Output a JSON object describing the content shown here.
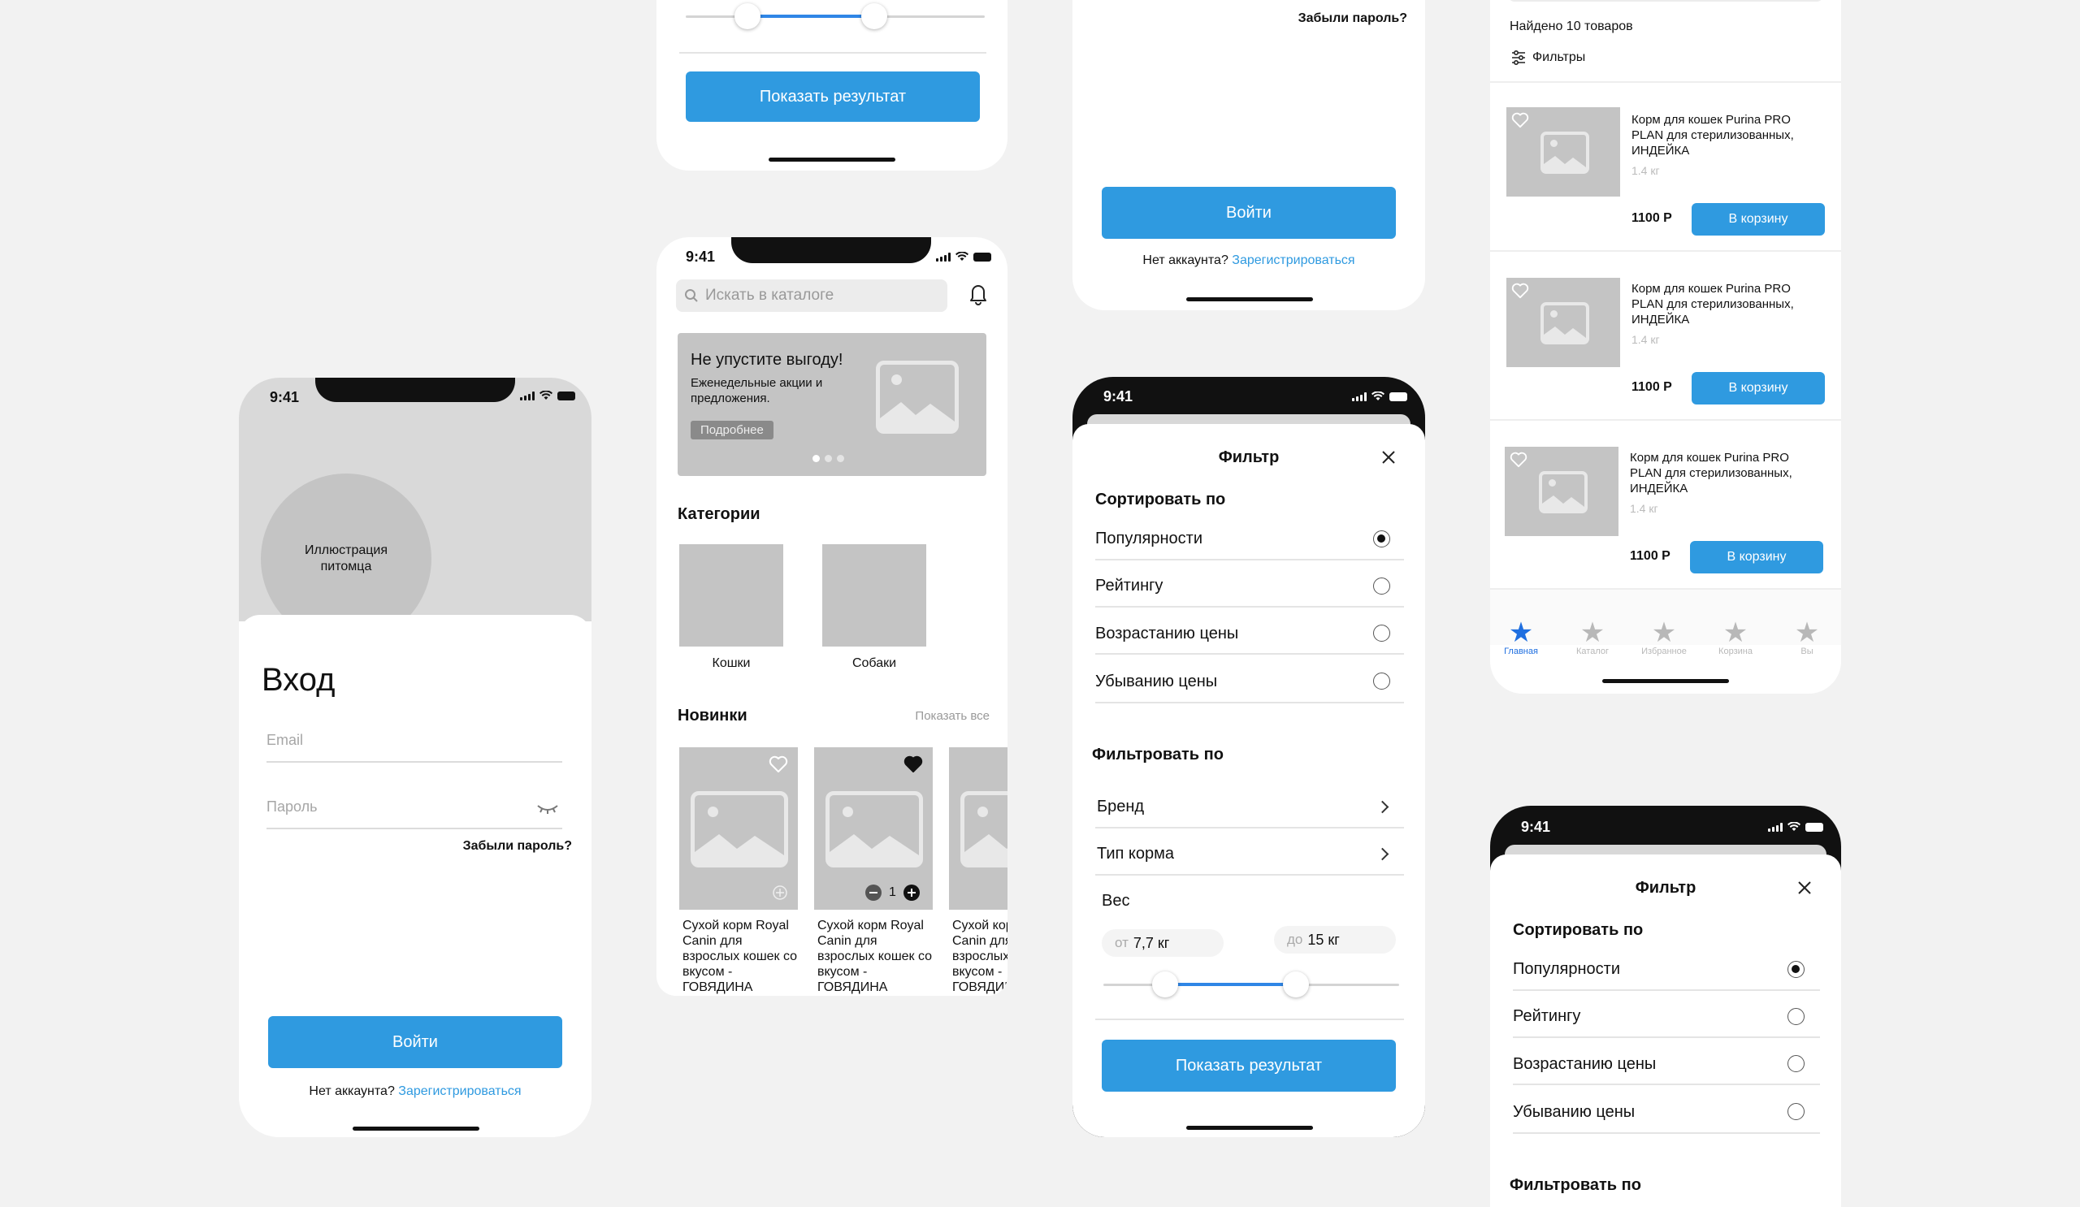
{
  "status": {
    "time": "9:41"
  },
  "login": {
    "illustration": "Иллюстрация питомца",
    "title": "Вход",
    "email_placeholder": "Email",
    "password_placeholder": "Пароль",
    "forgot": "Забыли пароль?",
    "submit": "Войти",
    "no_account": "Нет аккаунта?",
    "register": "Зарегистрироваться"
  },
  "login_partial": {
    "forgot": "Забыли пароль?",
    "submit": "Войти",
    "no_account": "Нет аккаунта?",
    "register": "Зарегистрироваться"
  },
  "filter_partial_top": {
    "show_result": "Показать результат"
  },
  "home": {
    "search_placeholder": "Искать в каталоге",
    "banner": {
      "title": "Не упустите выгоду!",
      "subtitle": "Еженедельные акции и предложения.",
      "more": "Подробнее"
    },
    "categories_title": "Категории",
    "categories": [
      {
        "label": "Кошки"
      },
      {
        "label": "Собаки"
      }
    ],
    "new_title": "Новинки",
    "show_all": "Показать все",
    "products": [
      {
        "name": "Сухой корм Royal Canin для взрослых кошек со вкусом - ГОВЯДИНА",
        "favorite": false
      },
      {
        "name": "Сухой корм Royal Canin для взрослых кошек со вкусом - ГОВЯДИНА",
        "favorite": true,
        "quantity": "1"
      },
      {
        "name": "Сухой корм Royal Canin для взрослых кошек со вкусом - ГОВЯДИНА",
        "favorite": false
      }
    ]
  },
  "filter": {
    "title": "Фильтр",
    "sort_title": "Сортировать по",
    "sort_options": [
      {
        "label": "Популярности",
        "selected": true
      },
      {
        "label": "Рейтингу",
        "selected": false
      },
      {
        "label": "Возрастанию цены",
        "selected": false
      },
      {
        "label": "Убыванию цены",
        "selected": false
      }
    ],
    "filter_title": "Фильтровать по",
    "filter_options": [
      {
        "label": "Бренд"
      },
      {
        "label": "Тип корма"
      }
    ],
    "weight": {
      "label": "Вес",
      "from_prefix": "от",
      "from": "7,7 кг",
      "to_prefix": "до",
      "to": "15 кг",
      "range_start": 0.21,
      "range_end": 0.65
    },
    "show_result": "Показать результат"
  },
  "catalog": {
    "found": "Найдено 10 товаров",
    "filters": "Фильтры",
    "items": [
      {
        "name": "Корм для кошек Purina PRO PLAN для стерилизованных, ИНДЕЙКА",
        "weight": "1.4 кг",
        "price": "1100 Р",
        "cart": "В корзину"
      },
      {
        "name": "Корм для кошек Purina PRO PLAN для стерилизованных, ИНДЕЙКА",
        "weight": "1.4 кг",
        "price": "1100 Р",
        "cart": "В корзину"
      },
      {
        "name": "Корм для кошек Purina PRO PLAN для стерилизованных, ИНДЕЙКА",
        "weight": "1.4 кг",
        "price": "1100 Р",
        "cart": "В корзину"
      }
    ],
    "tabs": [
      {
        "label": "Главная",
        "active": true
      },
      {
        "label": "Каталог",
        "active": false
      },
      {
        "label": "Избранное",
        "active": false
      },
      {
        "label": "Корзина",
        "active": false
      },
      {
        "label": "Вы",
        "active": false
      }
    ]
  },
  "colors": {
    "accent": "#2f9ae0",
    "background": "#f2f2f2",
    "placeholder": "#c4c4c4",
    "active_tab": "#1f6fe0"
  }
}
